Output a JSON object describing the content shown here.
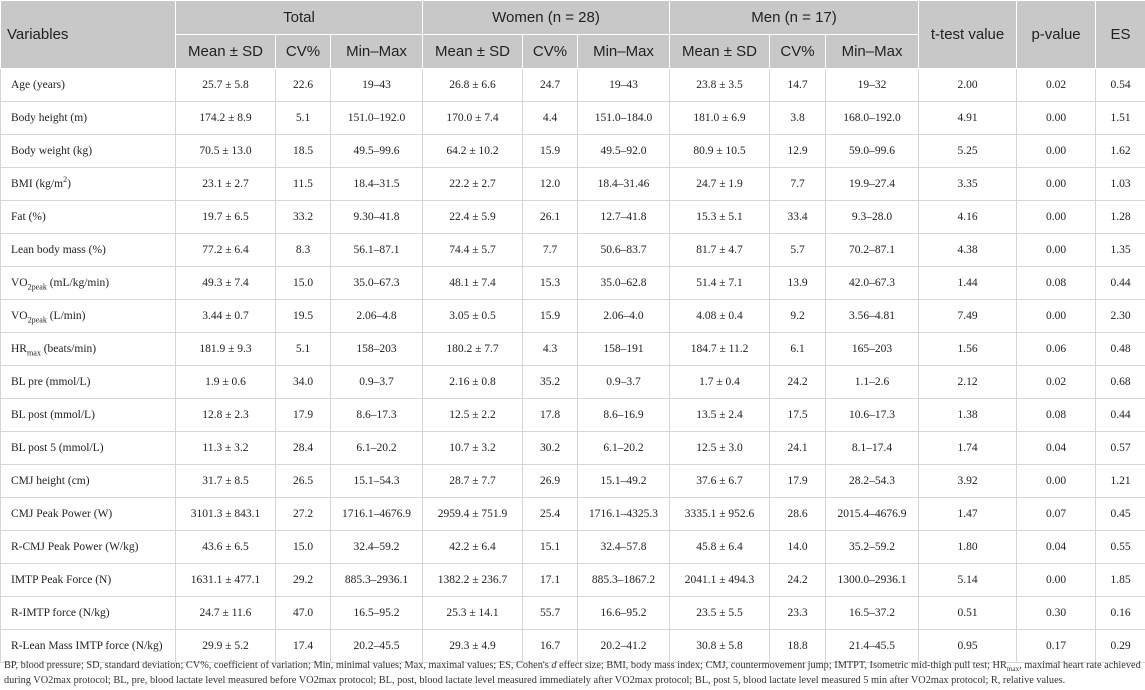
{
  "header": {
    "variables": "Variables",
    "groups": [
      "Total",
      "Women (n = 28)",
      "Men (n = 17)"
    ],
    "t_test": "t-test value",
    "p_value": "p-value",
    "es": "ES",
    "subheaders": [
      "Mean ± SD",
      "CV%",
      "Min–Max"
    ]
  },
  "rows": [
    {
      "pre": "Age (years)",
      "sub": "",
      "sup": "",
      "post": "",
      "cells": [
        "25.7 ± 5.8",
        "22.6",
        "19–43",
        "26.8 ± 6.6",
        "24.7",
        "19–43",
        "23.8 ± 3.5",
        "14.7",
        "19–32",
        "2.00",
        "0.02",
        "0.54"
      ]
    },
    {
      "pre": "Body height (m)",
      "sub": "",
      "sup": "",
      "post": "",
      "cells": [
        "174.2 ± 8.9",
        "5.1",
        "151.0–192.0",
        "170.0 ± 7.4",
        "4.4",
        "151.0–184.0",
        "181.0 ± 6.9",
        "3.8",
        "168.0–192.0",
        "4.91",
        "0.00",
        "1.51"
      ]
    },
    {
      "pre": "Body weight (kg)",
      "sub": "",
      "sup": "",
      "post": "",
      "cells": [
        "70.5 ± 13.0",
        "18.5",
        "49.5–99.6",
        "64.2 ± 10.2",
        "15.9",
        "49.5–92.0",
        "80.9 ± 10.5",
        "12.9",
        "59.0–99.6",
        "5.25",
        "0.00",
        "1.62"
      ]
    },
    {
      "pre": "BMI (kg/m",
      "sub": "",
      "sup": "2",
      "post": ")",
      "cells": [
        "23.1 ± 2.7",
        "11.5",
        "18.4–31.5",
        "22.2 ± 2.7",
        "12.0",
        "18.4–31.46",
        "24.7 ± 1.9",
        "7.7",
        "19.9–27.4",
        "3.35",
        "0.00",
        "1.03"
      ]
    },
    {
      "pre": "Fat (%)",
      "sub": "",
      "sup": "",
      "post": "",
      "cells": [
        "19.7 ± 6.5",
        "33.2",
        "9.30–41.8",
        "22.4 ± 5.9",
        "26.1",
        "12.7–41.8",
        "15.3 ± 5.1",
        "33.4",
        "9.3–28.0",
        "4.16",
        "0.00",
        "1.28"
      ]
    },
    {
      "pre": "Lean body mass (%)",
      "sub": "",
      "sup": "",
      "post": "",
      "cells": [
        "77.2 ± 6.4",
        "8.3",
        "56.1–87.1",
        "74.4 ± 5.7",
        "7.7",
        "50.6–83.7",
        "81.7 ± 4.7",
        "5.7",
        "70.2–87.1",
        "4.38",
        "0.00",
        "1.35"
      ]
    },
    {
      "pre": "VO",
      "sub": "2peak",
      "sup": "",
      "post": " (mL/kg/min)",
      "cells": [
        "49.3 ± 7.4",
        "15.0",
        "35.0–67.3",
        "48.1 ± 7.4",
        "15.3",
        "35.0–62.8",
        "51.4 ± 7.1",
        "13.9",
        "42.0–67.3",
        "1.44",
        "0.08",
        "0.44"
      ]
    },
    {
      "pre": "VO",
      "sub": "2peak",
      "sup": "",
      "post": " (L/min)",
      "cells": [
        "3.44 ± 0.7",
        "19.5",
        "2.06–4.8",
        "3.05 ± 0.5",
        "15.9",
        "2.06–4.0",
        "4.08 ± 0.4",
        "9.2",
        "3.56–4.81",
        "7.49",
        "0.00",
        "2.30"
      ]
    },
    {
      "pre": "HR",
      "sub": "max",
      "sup": "",
      "post": " (beats/min)",
      "cells": [
        "181.9 ± 9.3",
        "5.1",
        "158–203",
        "180.2 ± 7.7",
        "4.3",
        "158–191",
        "184.7 ± 11.2",
        "6.1",
        "165–203",
        "1.56",
        "0.06",
        "0.48"
      ]
    },
    {
      "pre": "BL pre (mmol/L)",
      "sub": "",
      "sup": "",
      "post": "",
      "cells": [
        "1.9 ± 0.6",
        "34.0",
        "0.9–3.7",
        "2.16 ± 0.8",
        "35.2",
        "0.9–3.7",
        "1.7 ± 0.4",
        "24.2",
        "1.1–2.6",
        "2.12",
        "0.02",
        "0.68"
      ]
    },
    {
      "pre": "BL post (mmol/L)",
      "sub": "",
      "sup": "",
      "post": "",
      "cells": [
        "12.8 ± 2.3",
        "17.9",
        "8.6–17.3",
        "12.5 ± 2.2",
        "17.8",
        "8.6–16.9",
        "13.5 ± 2.4",
        "17.5",
        "10.6–17.3",
        "1.38",
        "0.08",
        "0.44"
      ]
    },
    {
      "pre": "BL post 5 (mmol/L)",
      "sub": "",
      "sup": "",
      "post": "",
      "cells": [
        "11.3 ± 3.2",
        "28.4",
        "6.1–20.2",
        "10.7 ± 3.2",
        "30.2",
        "6.1–20.2",
        "12.5 ± 3.0",
        "24.1",
        "8.1–17.4",
        "1.74",
        "0.04",
        "0.57"
      ]
    },
    {
      "pre": "CMJ height (cm)",
      "sub": "",
      "sup": "",
      "post": "",
      "cells": [
        "31.7 ± 8.5",
        "26.5",
        "15.1–54.3",
        "28.7 ± 7.7",
        "26.9",
        "15.1–49.2",
        "37.6 ± 6.7",
        "17.9",
        "28.2–54.3",
        "3.92",
        "0.00",
        "1.21"
      ]
    },
    {
      "pre": "CMJ Peak Power (W)",
      "sub": "",
      "sup": "",
      "post": "",
      "cells": [
        "3101.3 ± 843.1",
        "27.2",
        "1716.1–4676.9",
        "2959.4 ± 751.9",
        "25.4",
        "1716.1–4325.3",
        "3335.1 ± 952.6",
        "28.6",
        "2015.4–4676.9",
        "1.47",
        "0.07",
        "0.45"
      ]
    },
    {
      "pre": "R-CMJ Peak Power (W/kg)",
      "sub": "",
      "sup": "",
      "post": "",
      "cells": [
        "43.6 ± 6.5",
        "15.0",
        "32.4–59.2",
        "42.2 ± 6.4",
        "15.1",
        "32.4–57.8",
        "45.8 ± 6.4",
        "14.0",
        "35.2–59.2",
        "1.80",
        "0.04",
        "0.55"
      ]
    },
    {
      "pre": "IMTP Peak Force (N)",
      "sub": "",
      "sup": "",
      "post": "",
      "cells": [
        "1631.1 ± 477.1",
        "29.2",
        "885.3–2936.1",
        "1382.2 ± 236.7",
        "17.1",
        "885.3–1867.2",
        "2041.1 ± 494.3",
        "24.2",
        "1300.0–2936.1",
        "5.14",
        "0.00",
        "1.85"
      ]
    },
    {
      "pre": "R-IMTP force (N/kg)",
      "sub": "",
      "sup": "",
      "post": "",
      "cells": [
        "24.7 ± 11.6",
        "47.0",
        "16.5–95.2",
        "25.3 ± 14.1",
        "55.7",
        "16.6–95.2",
        "23.5 ± 5.5",
        "23.3",
        "16.5–37.2",
        "0.51",
        "0.30",
        "0.16"
      ]
    },
    {
      "pre": "R-Lean Mass IMTP force (N/kg)",
      "sub": "",
      "sup": "",
      "post": "",
      "cells": [
        "29.9 ± 5.2",
        "17.4",
        "20.2–45.5",
        "29.3 ± 4.9",
        "16.7",
        "20.2–41.2",
        "30.8 ± 5.8",
        "18.8",
        "21.4–45.5",
        "0.95",
        "0.17",
        "0.29"
      ]
    }
  ],
  "footnote": {
    "a": "BP, blood pressure; SD, standard deviation; CV%, coefficient of variation; Min, minimal values; Max, maximal values; ES, Cohen's ",
    "d": "d",
    "b": " effect size; BMI, body mass index; CMJ, countermovement jump; IMTPT, Isometric mid-thigh pull test; HR",
    "max_sub": "max",
    "c": ", maximal heart rate achieved during VO2max protocol; BL, pre, blood lactate level measured before VO2max protocol; BL, post, blood lactate level measured immediately after VO2max protocol; BL, post 5, blood lactate level measured 5 min after VO2max protocol; R, relative values."
  }
}
